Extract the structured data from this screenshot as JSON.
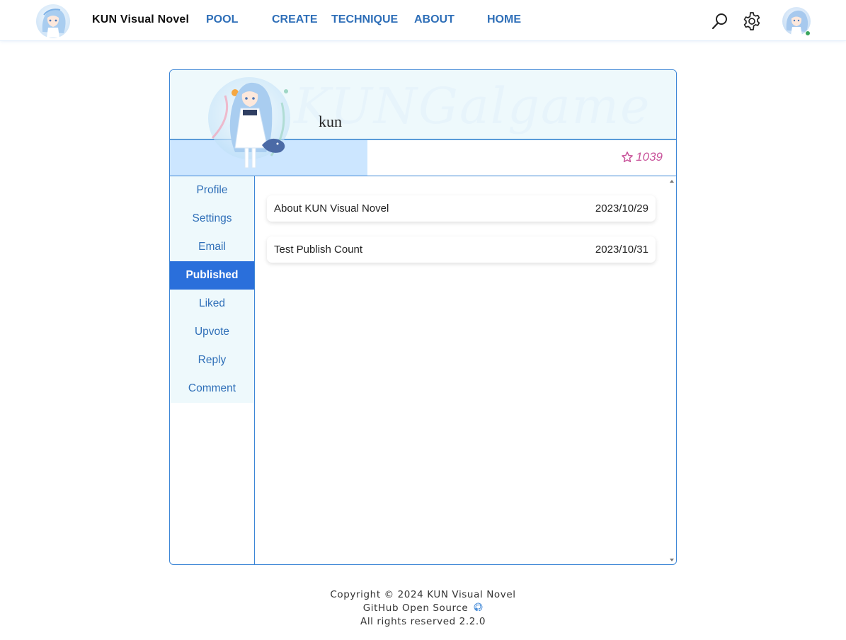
{
  "nav": {
    "site_title": "KUN Visual Novel",
    "links": [
      "POOL",
      "CREATE",
      "TECHNIQUE",
      "ABOUT",
      "HOME"
    ],
    "icons": [
      "search-icon",
      "settings-icon"
    ],
    "link_color": "#2f6fb8"
  },
  "profile": {
    "username": "kun",
    "watermark": "KUNGalgame",
    "points": "1039",
    "points_icon": "star-outline-icon"
  },
  "sidebar": {
    "items": [
      "Profile",
      "Settings",
      "Email",
      "Published",
      "Liked",
      "Upvote",
      "Reply",
      "Comment"
    ],
    "active": "Published",
    "accent_color": "#2a6fdb"
  },
  "posts": [
    {
      "title": "About KUN Visual Novel",
      "date": "2023/10/29"
    },
    {
      "title": "Test Publish Count",
      "date": "2023/10/31"
    }
  ],
  "footer": {
    "copyright": "Copyright © 2024 KUN Visual Novel",
    "github": "GitHub Open Source",
    "rights": "All rights reserved 2.2.0"
  }
}
